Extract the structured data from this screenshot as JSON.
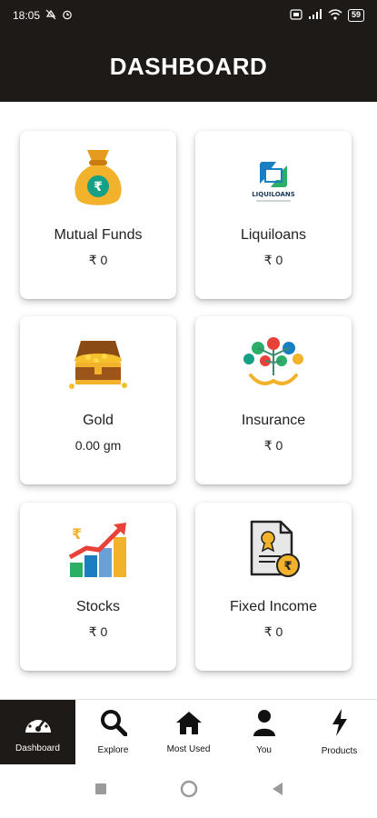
{
  "status_bar": {
    "time": "18:05",
    "left_icons": [
      "mute-icon",
      "alarm-icon"
    ],
    "right_icons": [
      "sim-icon",
      "signal-icon",
      "wifi-icon"
    ],
    "battery": "59"
  },
  "header": {
    "title": "DASHBOARD"
  },
  "cards": [
    {
      "title": "Mutual Funds",
      "value": "₹ 0",
      "icon": "money-bag-icon"
    },
    {
      "title": "Liquiloans",
      "value": "₹ 0",
      "icon": "liquiloans-logo",
      "logo_text": "LIQUILOANS"
    },
    {
      "title": "Gold",
      "value": "0.00 gm",
      "icon": "treasure-chest-icon"
    },
    {
      "title": "Insurance",
      "value": "₹ 0",
      "icon": "insurance-tree-icon"
    },
    {
      "title": "Stocks",
      "value": "₹ 0",
      "icon": "growth-chart-icon"
    },
    {
      "title": "Fixed Income",
      "value": "₹ 0",
      "icon": "certificate-icon"
    }
  ],
  "bottom_nav": [
    {
      "label": "Dashboard",
      "icon": "speedometer-icon",
      "active": true
    },
    {
      "label": "Explore",
      "icon": "search-icon",
      "active": false
    },
    {
      "label": "Most Used",
      "icon": "home-icon",
      "active": false
    },
    {
      "label": "You",
      "icon": "user-icon",
      "active": false
    },
    {
      "label": "Products",
      "icon": "lightning-icon",
      "active": false
    }
  ],
  "system_nav": [
    "recents-icon",
    "home-circle-icon",
    "back-icon"
  ],
  "colors": {
    "header_bg": "#1d1a18",
    "gold": "#f3b22b",
    "rupee_green": "#16a085",
    "chart_red": "#e8413a",
    "logo_blue": "#1a7fc1",
    "logo_green": "#2bae66"
  }
}
